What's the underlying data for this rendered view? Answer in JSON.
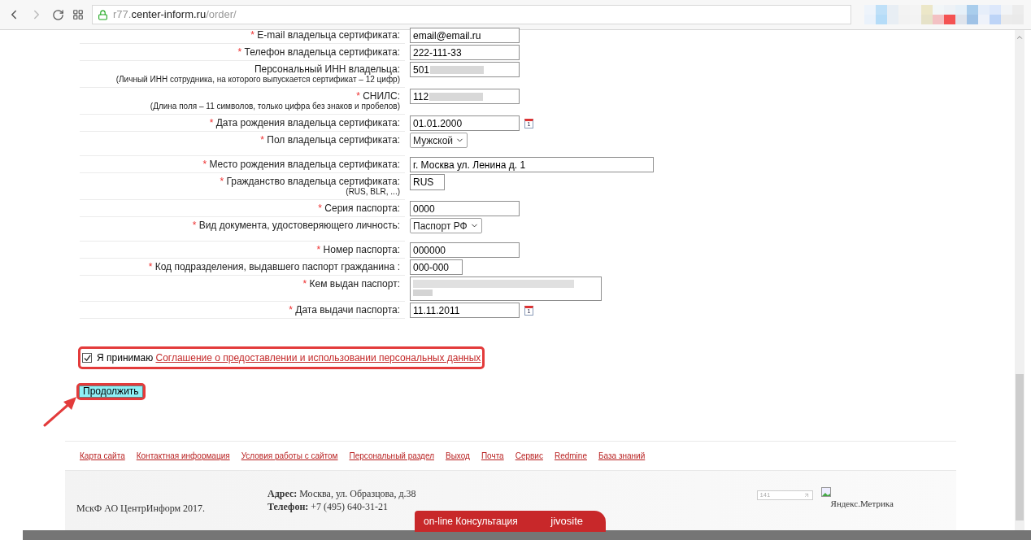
{
  "browser": {
    "url_host_prefix": "r77.",
    "url_host": "center-inform.ru",
    "url_path": "/order/"
  },
  "form": {
    "rows": [
      {
        "kind": "text",
        "required": true,
        "label": "E-mail владельца сертификата:",
        "value": "email@email.ru",
        "blurred": false
      },
      {
        "kind": "text",
        "required": true,
        "label": "Телефон владельца сертификата:",
        "value": "222-111-33",
        "blurred": false
      },
      {
        "kind": "text",
        "required": false,
        "label": "Персональный ИНН владельца:",
        "hint": "(Личный ИНН сотрудника, на которого выпускается сертификат – 12 цифр)",
        "value": "501",
        "blurred": true
      },
      {
        "kind": "text",
        "required": true,
        "label": "СНИЛС:",
        "hint": "(Длина поля – 11 символов, только цифра без знаков и пробелов)",
        "value": "112",
        "blurred": true
      },
      {
        "kind": "date",
        "required": true,
        "label": "Дата рождения владельца сертификата:",
        "value": "01.01.2000",
        "calendar": "1",
        "blurred": false
      },
      {
        "kind": "select",
        "required": true,
        "label": "Пол владельца сертификата:",
        "value": "Мужской",
        "blurred": false
      },
      {
        "kind": "wide",
        "required": true,
        "label": "Место рождения владельца сертификата:",
        "value": "г. Москва ул. Ленина д. 1",
        "blurred": false
      },
      {
        "kind": "short",
        "required": true,
        "label": "Гражданство владельца сертификата:",
        "hint": "(RUS, BLR, ...)",
        "value": "RUS",
        "blurred": false
      },
      {
        "kind": "text",
        "required": true,
        "label": "Серия паспорта:",
        "value": "0000",
        "blurred": false
      },
      {
        "kind": "select",
        "required": true,
        "label": "Вид документа, удостоверяющего личность:",
        "value": "Паспорт РФ",
        "blurred": false
      },
      {
        "kind": "text",
        "required": true,
        "label": "Номер паспорта:",
        "value": "000000",
        "blurred": false
      },
      {
        "kind": "medium",
        "required": true,
        "label": "Код подразделения, выдавшего паспорт гражданина :",
        "value": "000-000",
        "blurred": false
      },
      {
        "kind": "textarea",
        "required": true,
        "label": "Кем выдан паспорт:",
        "blurred": true
      },
      {
        "kind": "date",
        "required": true,
        "label": "Дата выдачи паспорта:",
        "value": "11.11.2011",
        "calendar": "1",
        "blurred": false
      }
    ],
    "required_mark": "*",
    "consent": {
      "checked": true,
      "prefix": "Я принимаю",
      "link": "Соглашение о предоставлении и использовании персональных данных"
    },
    "submit": "Продолжить"
  },
  "footer": {
    "links": [
      "Карта сайта",
      "Контактная информация",
      "Условия работы с сайтом",
      "Персональный раздел",
      "Выход",
      "Почта",
      "Сервис",
      "Redmine",
      "База знаний"
    ],
    "copyright": "МскФ АО ЦентрИнформ 2017.",
    "address_label": "Адрес:",
    "address": "Москва, ул. Образцова, д.38",
    "phone_label": "Телефон:",
    "phone": "+7 (495) 640-31-21",
    "counter": "141",
    "metrika": "Яндекс.Метрика"
  },
  "chat": {
    "label": "on-line Консультация",
    "brand": "jivosite"
  }
}
